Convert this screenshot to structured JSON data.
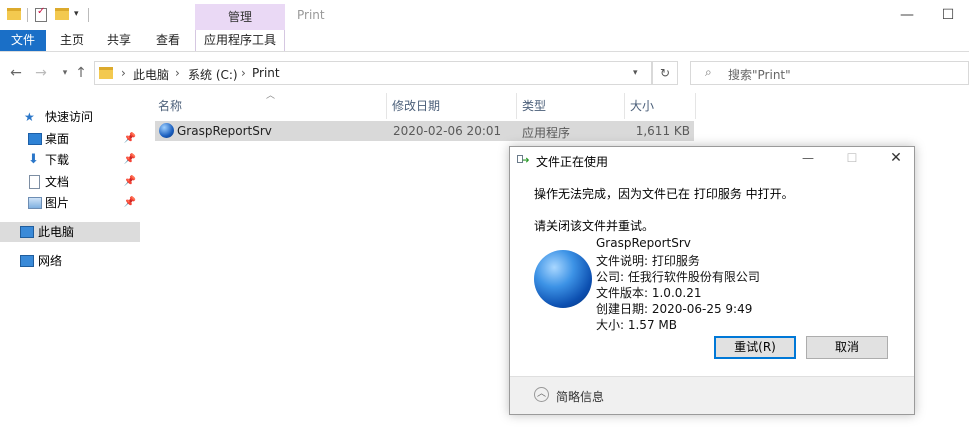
{
  "window": {
    "title": "Print",
    "context_tab": "管理"
  },
  "ribbon": {
    "tabs": [
      "文件",
      "主页",
      "共享",
      "查看",
      "应用程序工具"
    ]
  },
  "address": {
    "crumbs": [
      "此电脑",
      "系统 (C:)",
      "Print"
    ],
    "search_placeholder": "搜索\"Print\""
  },
  "nav": {
    "quick_access": "快速访问",
    "items": [
      "桌面",
      "下载",
      "文档",
      "图片"
    ],
    "this_pc": "此电脑",
    "network": "网络"
  },
  "list": {
    "columns": [
      "名称",
      "修改日期",
      "类型",
      "大小"
    ],
    "rows": [
      {
        "name": "GraspReportSrv",
        "date": "2020-02-06 20:01",
        "type": "应用程序",
        "size": "1,611 KB"
      }
    ]
  },
  "dialog": {
    "title": "文件正在使用",
    "message": "操作无法完成，因为文件已在 打印服务 中打开。",
    "hint": "请关闭该文件并重试。",
    "file_name": "GraspReportSrv",
    "desc": "文件说明: 打印服务",
    "company": "公司: 任我行软件股份有限公司",
    "version": "文件版本: 1.0.0.21",
    "created": "创建日期: 2020-06-25 9:49",
    "size": "大小: 1.57 MB",
    "retry": "重试(R)",
    "cancel": "取消",
    "details": "简略信息"
  },
  "colors": {
    "accent": "#1a6fc7",
    "context_tab": "#ead9f5",
    "selection": "#d9d9d9"
  }
}
